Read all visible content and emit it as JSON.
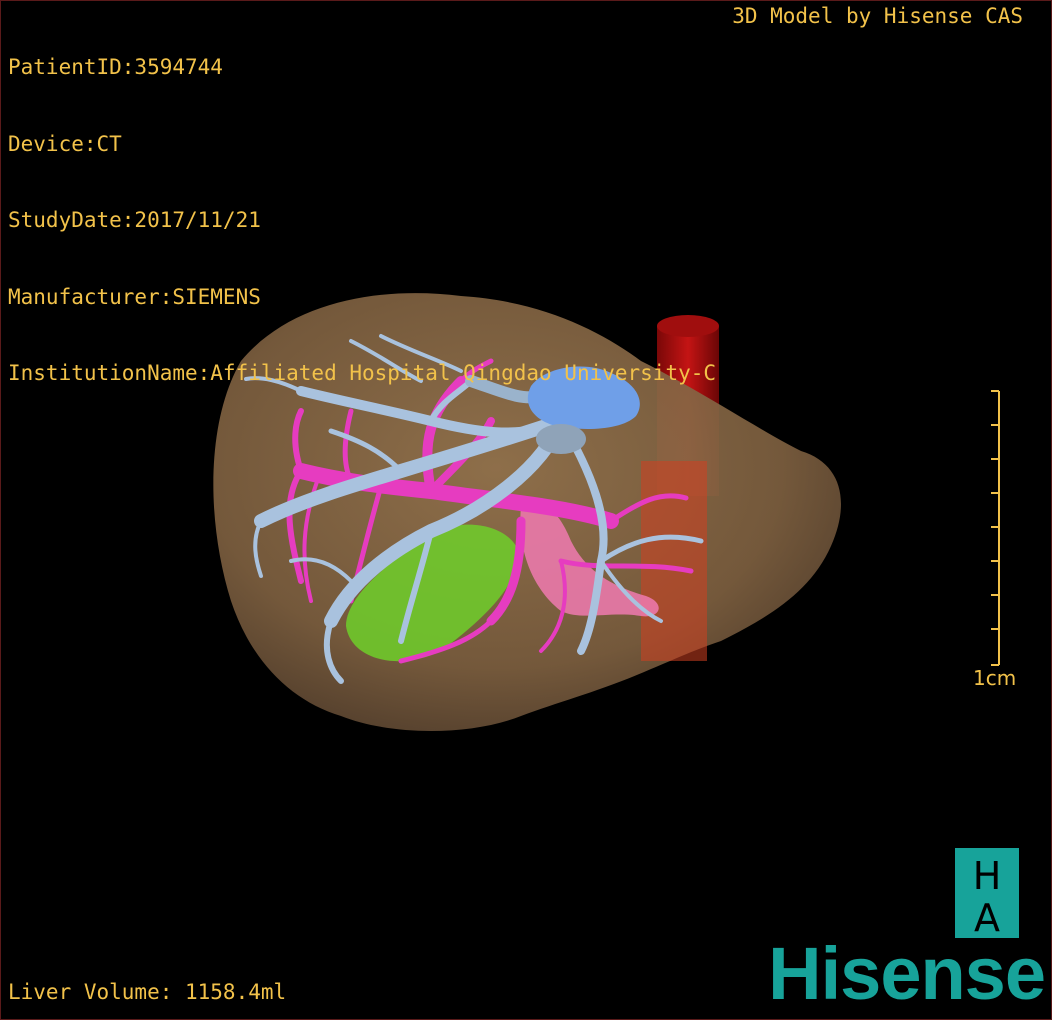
{
  "patient_info": {
    "patient_id": "PatientID:3594744",
    "device": "Device:CT",
    "study_date": "StudyDate:2017/11/21",
    "manufacturer": "Manufacturer:SIEMENS",
    "institution": "InstitutionName:Affiliated Hospital Qingdao University-C"
  },
  "model_credit": "3D Model by Hisense CAS",
  "liver_volume": "Liver Volume: 1158.4ml",
  "scale_bar": {
    "label": "1cm"
  },
  "logo": {
    "top_letter": "H",
    "bottom_letter": "A",
    "brand": "Hisense"
  },
  "colors": {
    "overlay_text": "#f2c24a",
    "liver": "#8a6a44",
    "hepatic_vein": "#a9c2de",
    "portal_vein": "#e63cc0",
    "gallbladder": "#6fcf2a",
    "ivc": "#b00f10",
    "tumor": "#6f9fe8",
    "pancreas": "#f07ab0",
    "brand": "#17a39a"
  }
}
